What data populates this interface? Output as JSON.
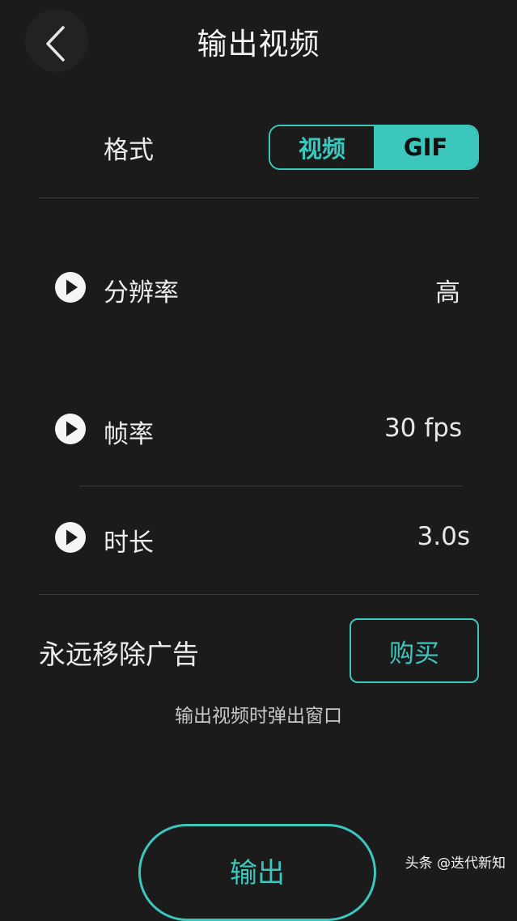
{
  "header": {
    "title": "输出视频",
    "back_icon": "chevron-left-icon"
  },
  "format": {
    "label": "格式",
    "options": [
      "视频",
      "GIF"
    ],
    "selected": "GIF"
  },
  "settings": [
    {
      "label": "分辨率",
      "value": "高",
      "icon": "play-circle-icon"
    },
    {
      "label": "帧率",
      "value": "30 fps",
      "icon": "play-circle-icon"
    },
    {
      "label": "时长",
      "value": "3.0s",
      "icon": "play-circle-icon"
    }
  ],
  "ads": {
    "label": "永远移除广告",
    "buy_label": "购买",
    "note": "输出视频时弹出窗口"
  },
  "export": {
    "label": "输出"
  },
  "watermark": {
    "text": "头条 @迭代新知"
  },
  "colors": {
    "accent": "#3cc7bd",
    "background": "#1b1b1c"
  }
}
